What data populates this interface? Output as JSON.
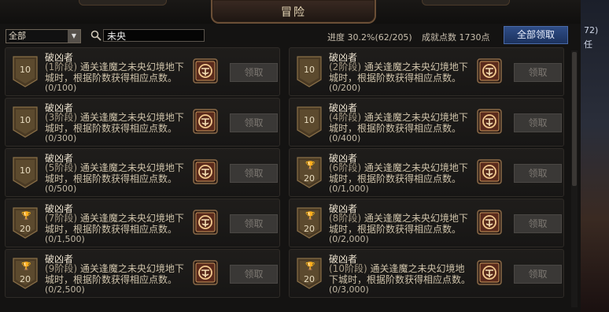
{
  "window": {
    "title": "冒险"
  },
  "filter": {
    "selected": "全部"
  },
  "search": {
    "value": "未央"
  },
  "stats": {
    "progress_label": "进度",
    "progress_value": "30.2%(62/205)",
    "points_label": "成就点数",
    "points_value": "1730点"
  },
  "buttons": {
    "claim_all": "全部领取",
    "claim": "领取"
  },
  "side": {
    "line1": "72)",
    "line2": "任"
  },
  "achievements": [
    {
      "name": "破凶者",
      "stage": "(1阶段)",
      "desc": "通关逢魔之未央幻境地下城时，根据阶数获得相应点数。",
      "progress": "(0/100)",
      "points": "10",
      "badge": "plain"
    },
    {
      "name": "破凶者",
      "stage": "(2阶段)",
      "desc": "通关逢魔之未央幻境地下城时，根据阶数获得相应点数。",
      "progress": "(0/200)",
      "points": "10",
      "badge": "plain"
    },
    {
      "name": "破凶者",
      "stage": "(3阶段)",
      "desc": "通关逢魔之未央幻境地下城时，根据阶数获得相应点数。",
      "progress": "(0/300)",
      "points": "10",
      "badge": "plain"
    },
    {
      "name": "破凶者",
      "stage": "(4阶段)",
      "desc": "通关逢魔之未央幻境地下城时，根据阶数获得相应点数。",
      "progress": "(0/400)",
      "points": "10",
      "badge": "plain"
    },
    {
      "name": "破凶者",
      "stage": "(5阶段)",
      "desc": "通关逢魔之未央幻境地下城时，根据阶数获得相应点数。",
      "progress": "(0/500)",
      "points": "10",
      "badge": "plain"
    },
    {
      "name": "破凶者",
      "stage": "(6阶段)",
      "desc": "通关逢魔之未央幻境地下城时，根据阶数获得相应点数。",
      "progress": "(0/1,000)",
      "points": "20",
      "badge": "trophy"
    },
    {
      "name": "破凶者",
      "stage": "(7阶段)",
      "desc": "通关逢魔之未央幻境地下城时，根据阶数获得相应点数。",
      "progress": "(0/1,500)",
      "points": "20",
      "badge": "trophy"
    },
    {
      "name": "破凶者",
      "stage": "(8阶段)",
      "desc": "通关逢魔之未央幻境地下城时，根据阶数获得相应点数。",
      "progress": "(0/2,000)",
      "points": "20",
      "badge": "trophy"
    },
    {
      "name": "破凶者",
      "stage": "(9阶段)",
      "desc": "通关逢魔之未央幻境地下城时，根据阶数获得相应点数。",
      "progress": "(0/2,500)",
      "points": "20",
      "badge": "trophy"
    },
    {
      "name": "破凶者",
      "stage": "(10阶段)",
      "desc": "通关逢魔之未央幻境地下城时，根据阶数获得相应点数。",
      "progress": "(0/3,000)",
      "points": "20",
      "badge": "trophy"
    }
  ]
}
